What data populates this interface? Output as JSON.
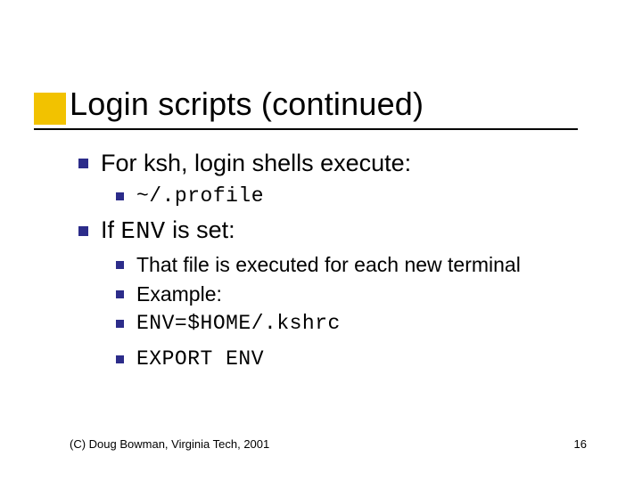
{
  "title": "Login scripts (continued)",
  "bullets": {
    "b1": {
      "text": "For ksh, login shells execute:"
    },
    "b1_1": {
      "text": "~/.profile"
    },
    "b2": {
      "prefix": "If ",
      "code": "ENV",
      "suffix": " is set:"
    },
    "b2_1": {
      "text": "That file is executed for each new terminal"
    },
    "b2_2": {
      "text": "Example:"
    },
    "b2_3": {
      "text": "ENV=$HOME/.kshrc"
    },
    "b2_4": {
      "text": "EXPORT ENV"
    }
  },
  "footer": {
    "copyright": "(C) Doug Bowman, Virginia Tech, 2001",
    "page": "16"
  }
}
